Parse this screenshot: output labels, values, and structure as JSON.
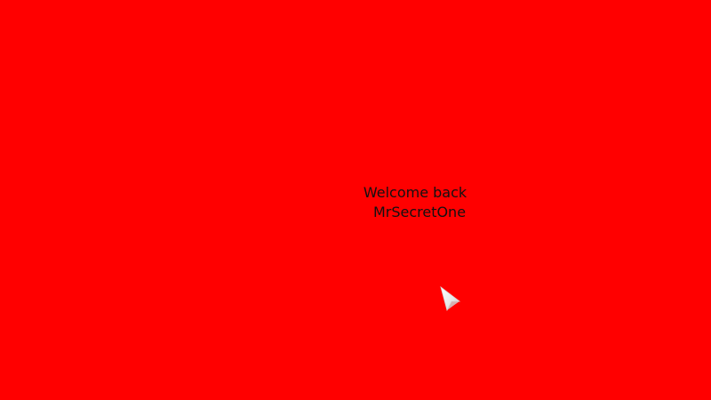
{
  "screen": {
    "background_color": "#ff0000",
    "text_color": "#111111"
  },
  "welcome": {
    "greeting": "Welcome back",
    "username": "MrSecretOne"
  },
  "cursor": {
    "icon": "mouse-pointer-icon"
  }
}
